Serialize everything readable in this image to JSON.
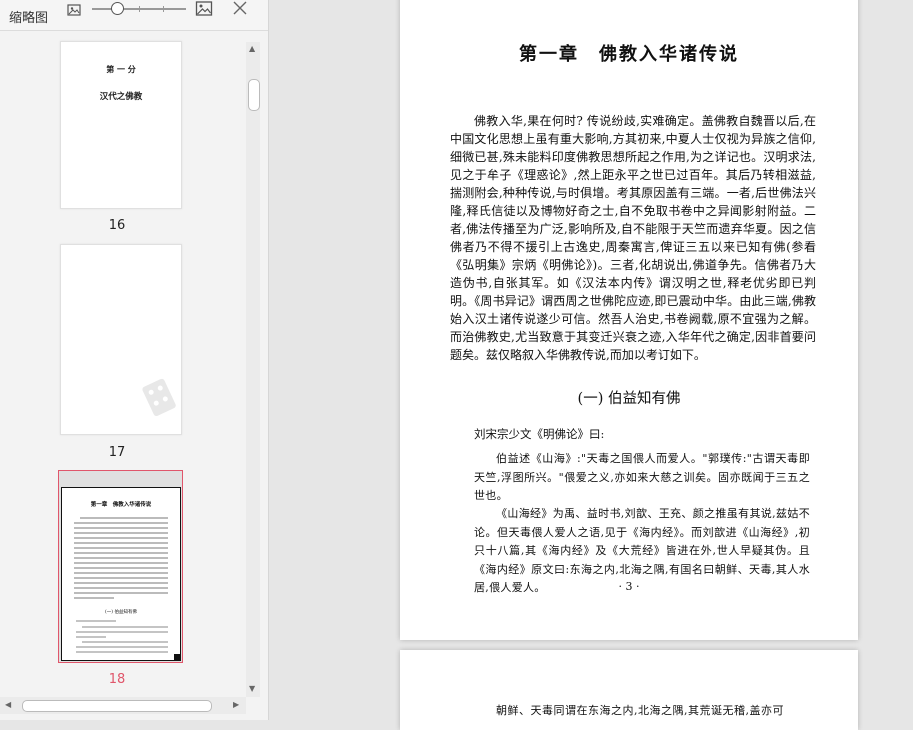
{
  "thumbnail_panel": {
    "title": "缩略图",
    "icons": [
      "small-image-icon",
      "zoom-slider",
      "large-image-icon",
      "close-icon"
    ],
    "pages": [
      {
        "number": "16",
        "heading": "第 一 分",
        "subtitle": "汉代之佛教"
      },
      {
        "number": "17"
      },
      {
        "number": "18",
        "active": true
      }
    ],
    "thumb18": {
      "title": "第一章　佛教入华诸传说",
      "section": "(一) 伯益知有佛"
    }
  },
  "colors": {
    "accent": "#e0566b",
    "panel_bg": "#f3f3f3",
    "viewer_bg": "#e6e6e6"
  },
  "document": {
    "chapter_title": "第一章　佛教入华诸传说",
    "body": "佛教入华,果在何时? 传说纷歧,实难确定。盖佛教自魏晋以后,在中国文化思想上虽有重大影响,方其初来,中夏人士仅视为异族之信仰,细微已甚,殊未能料印度佛教思想所起之作用,为之详记也。汉明求法,见之于牟子《理惑论》,然上距永平之世已过百年。其后乃转相滋益,揣测附会,种种传说,与时俱增。考其原因盖有三端。一者,后世佛法兴隆,释氏信徒以及博物好奇之士,自不免取书卷中之异闻影射附益。二者,佛法传播至为广泛,影响所及,自不能限于天竺而遗弃华夏。因之信佛者乃不得不援引上古逸史,周秦寓言,俾证三五以来已知有佛(参看《弘明集》宗炳《明佛论》)。三者,化胡说出,佛道争先。信佛者乃大造伪书,自张其军。如《汉法本内传》谓汉明之世,释老优劣即已判明。《周书异记》谓西周之世佛陀应迹,即已震动中华。由此三端,佛教始入汉土诸传说遂少可信。然吾人治史,书卷阙载,原不宜强为之解。而治佛教史,尤当致意于其变迁兴衰之迹,入华年代之确定,因非首要问题矣。兹仅略叙入华佛教传说,而加以考订如下。",
    "section_heading": "(一) 伯益知有佛",
    "quote_intro": "刘宋宗少文《明佛论》曰:",
    "quote1": "伯益述《山海》:\"天毒之国偎人而爱人。\"郭璞传:\"古谓天毒即天竺,浮图所兴。\"偎爱之义,亦如来大慈之训矣。固亦既闻于三五之世也。",
    "quote2": "《山海经》为禹、益时书,刘歆、王充、颜之推虽有其说,兹姑不论。但天毒偎人爱人之语,见于《海内经》。而刘歆进《山海经》,初只十八篇,其《海内经》及《大荒经》皆进在外,世人早疑其伪。且《海内经》原文曰:东海之内,北海之隅,有国名曰朝鲜、天毒,其人水居,偎人爱人。",
    "page_number": "· 3 ·",
    "next_page_text": "朝鲜、天毒同谓在东海之内,北海之隅,其荒诞无稽,盖亦可"
  }
}
